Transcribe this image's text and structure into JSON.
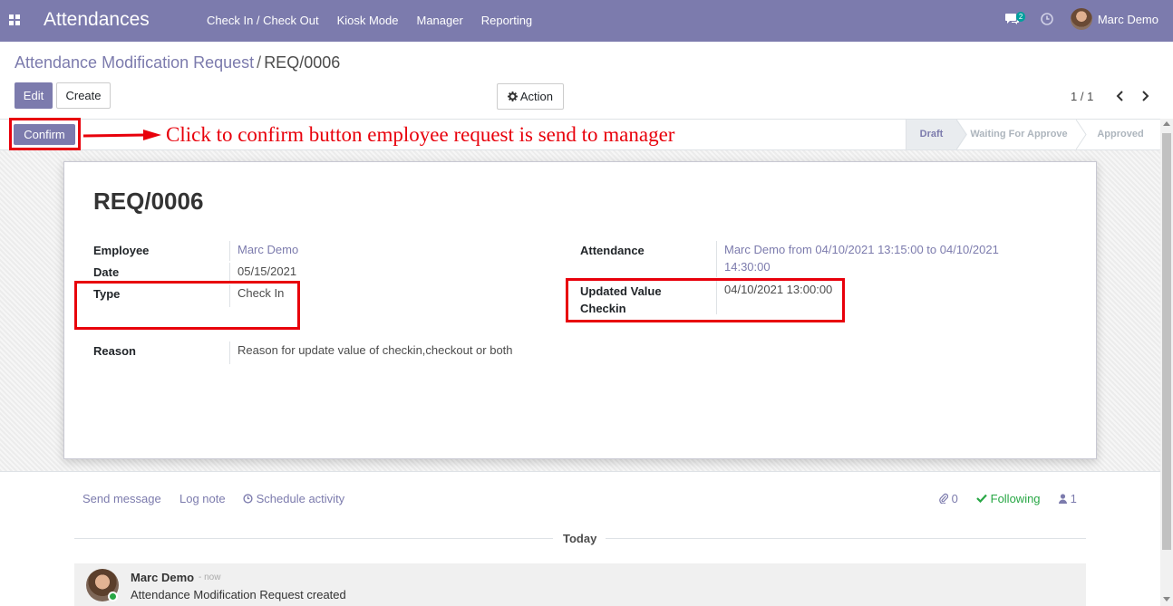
{
  "navbar": {
    "app_title": "Attendances",
    "menu": [
      "Check In / Check Out",
      "Kiosk Mode",
      "Manager",
      "Reporting"
    ],
    "chat_count": "2",
    "user_name": "Marc Demo",
    "bg_color": "#7c7bad"
  },
  "breadcrumb": {
    "parent": "Attendance Modification Request",
    "separator": "/",
    "current": "REQ/0006"
  },
  "buttons": {
    "edit": "Edit",
    "create": "Create",
    "action": "Action",
    "confirm": "Confirm"
  },
  "pager": {
    "value": "1 / 1"
  },
  "annotation": {
    "text": "Click to confirm button employee request is send to manager",
    "color": "#e8000b"
  },
  "statusbar": {
    "stages": [
      "Draft",
      "Waiting For Approve",
      "Approved"
    ],
    "active": "Draft"
  },
  "record": {
    "title": "REQ/0006",
    "employee_label": "Employee",
    "employee": "Marc Demo",
    "date_label": "Date",
    "date": "05/15/2021",
    "type_label": "Type",
    "type": "Check In",
    "reason_label": "Reason",
    "reason": "Reason for update value of checkin,checkout or both",
    "attendance_label": "Attendance",
    "attendance_line1": "Marc Demo from 04/10/2021 13:15:00 to 04/10/2021",
    "attendance_line2": "14:30:00",
    "updated_label_line1": "Updated Value",
    "updated_label_line2": "Checkin",
    "updated_value": "04/10/2021 13:00:00"
  },
  "chatter": {
    "send_message": "Send message",
    "log_note": "Log note",
    "schedule_activity": "Schedule activity",
    "attachments": "0",
    "following": "Following",
    "followers": "1",
    "today": "Today",
    "message": {
      "author": "Marc Demo",
      "time": "- now",
      "body": "Attendance Modification Request created"
    }
  }
}
